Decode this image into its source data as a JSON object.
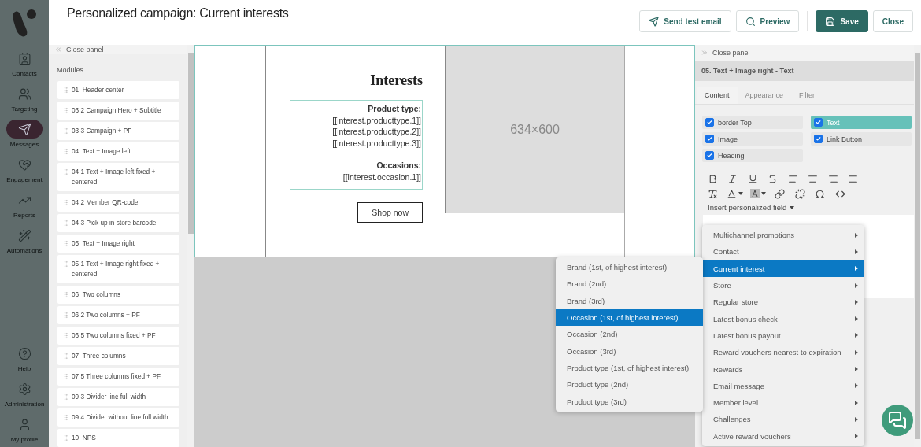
{
  "nav": {
    "items": [
      {
        "label": "Contacts",
        "selected": false
      },
      {
        "label": "Targeting",
        "selected": false
      },
      {
        "label": "Messages",
        "selected": true
      },
      {
        "label": "Engagement",
        "selected": false
      },
      {
        "label": "Reports",
        "selected": false
      },
      {
        "label": "Automations",
        "selected": false
      }
    ],
    "bottom_items": [
      {
        "label": "Help",
        "selected": false
      },
      {
        "label": "Administration",
        "selected": false
      },
      {
        "label": "My profile",
        "selected": false
      }
    ]
  },
  "header": {
    "title": "Personalized campaign: Current interests",
    "buttons": [
      {
        "label": "Send test email",
        "primary": false
      },
      {
        "label": "Preview",
        "primary": false
      },
      {
        "label": "Save",
        "primary": true
      },
      {
        "label": "Close",
        "primary": false
      }
    ]
  },
  "left_panel": {
    "close_label": "Close panel",
    "section_title": "Modules",
    "modules": [
      "01. Header center",
      "03.2 Campaign Hero + Subtitle",
      "03.3 Campaign + PF",
      "04. Text + Image left",
      "04.1 Text + Image left fixed + centered",
      "04.2 Member QR-code",
      "04.3 Pick up in store barcode",
      "05. Text + Image right",
      "05.1 Text + Image right fixed + centered",
      "06. Two columns",
      "06.2 Two columns + PF",
      "06.5 Two columns fixed + PF",
      "07. Three columns",
      "07.5 Three columns fixed + PF",
      "09.3 Divider line full width",
      "09.4 Divider without line full width",
      "10. NPS"
    ]
  },
  "email": {
    "heading": "Interests",
    "lines": [
      {
        "kind": "label",
        "text": "Product type:"
      },
      {
        "kind": "value",
        "text": "[[interest.producttype.1]]"
      },
      {
        "kind": "value",
        "text": "[[interest.producttype.2]]"
      },
      {
        "kind": "value",
        "text": "[[interest.producttype.3]]"
      },
      {
        "kind": "gap"
      },
      {
        "kind": "label",
        "text": "Occasions:"
      },
      {
        "kind": "value",
        "text": "[[interest.occasion.1]]"
      }
    ],
    "button": "Shop now",
    "image_label": "634×600"
  },
  "right_panel": {
    "close_label": "Close panel",
    "title": "05. Text + Image right - Text",
    "tabs": [
      {
        "label": "Content",
        "selected": true
      },
      {
        "label": "Appearance",
        "selected": false
      },
      {
        "label": "Filter",
        "selected": false
      }
    ],
    "elements": [
      {
        "label": "border Top",
        "checked": true,
        "selected": false
      },
      {
        "label": "Text",
        "checked": true,
        "selected": true
      },
      {
        "label": "Image",
        "checked": true,
        "selected": false
      },
      {
        "label": "Link Button",
        "checked": true,
        "selected": false
      },
      {
        "label": "Heading",
        "checked": true,
        "selected": false
      }
    ],
    "insert_field": "Insert personalized field"
  },
  "menu": {
    "items": [
      {
        "label": "Multichannel promotions",
        "selected": false
      },
      {
        "label": "Contact",
        "selected": false
      },
      {
        "label": "Current interest",
        "selected": true
      },
      {
        "label": "Store",
        "selected": false
      },
      {
        "label": "Regular store",
        "selected": false
      },
      {
        "label": "Latest bonus check",
        "selected": false
      },
      {
        "label": "Latest bonus payout",
        "selected": false
      },
      {
        "label": "Reward vouchers nearest to expiration",
        "selected": false
      },
      {
        "label": "Rewards",
        "selected": false
      },
      {
        "label": "Email message",
        "selected": false
      },
      {
        "label": "Member level",
        "selected": false
      },
      {
        "label": "Challenges",
        "selected": false
      },
      {
        "label": "Active reward vouchers",
        "selected": false
      }
    ]
  },
  "submenu": {
    "items": [
      {
        "label": "Brand (1st, of highest interest)",
        "selected": false
      },
      {
        "label": "Brand (2nd)",
        "selected": false
      },
      {
        "label": "Brand (3rd)",
        "selected": false
      },
      {
        "label": "Occasion (1st, of highest interest)",
        "selected": true
      },
      {
        "label": "Occasion (2nd)",
        "selected": false
      },
      {
        "label": "Occasion (3rd)",
        "selected": false
      },
      {
        "label": "Product type (1st, of highest interest)",
        "selected": false
      },
      {
        "label": "Product type (2nd)",
        "selected": false
      },
      {
        "label": "Product type (3rd)",
        "selected": false
      }
    ]
  }
}
